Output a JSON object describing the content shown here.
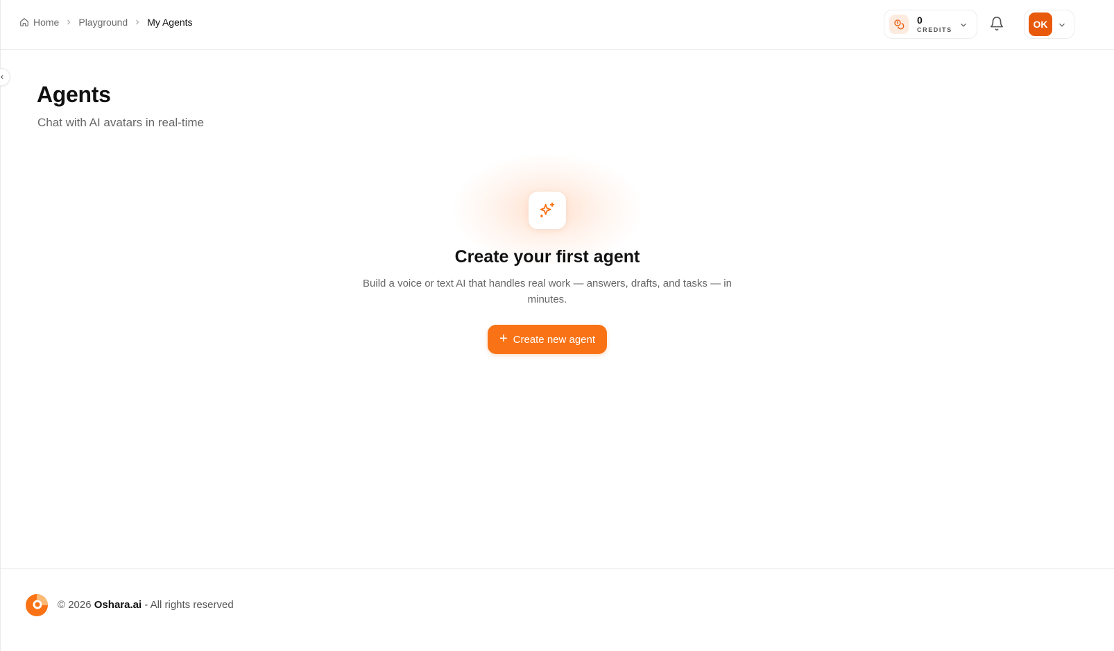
{
  "breadcrumb": {
    "home": "Home",
    "playground": "Playground",
    "current": "My Agents"
  },
  "credits": {
    "value": "0",
    "label": "CREDITS"
  },
  "user": {
    "initials": "OK"
  },
  "page": {
    "title": "Agents",
    "subtitle": "Chat with AI avatars in real-time"
  },
  "empty_state": {
    "title": "Create your first agent",
    "description": "Build a voice or text AI that handles real work — answers, drafts, and tasks — in minutes.",
    "button_label": "Create new agent",
    "icon": "sparkles-icon"
  },
  "footer": {
    "prefix": "© 2026",
    "brand": "Oshara.ai",
    "suffix": "- All rights reserved"
  },
  "colors": {
    "accent": "#f97316",
    "avatar": "#e8590c"
  }
}
